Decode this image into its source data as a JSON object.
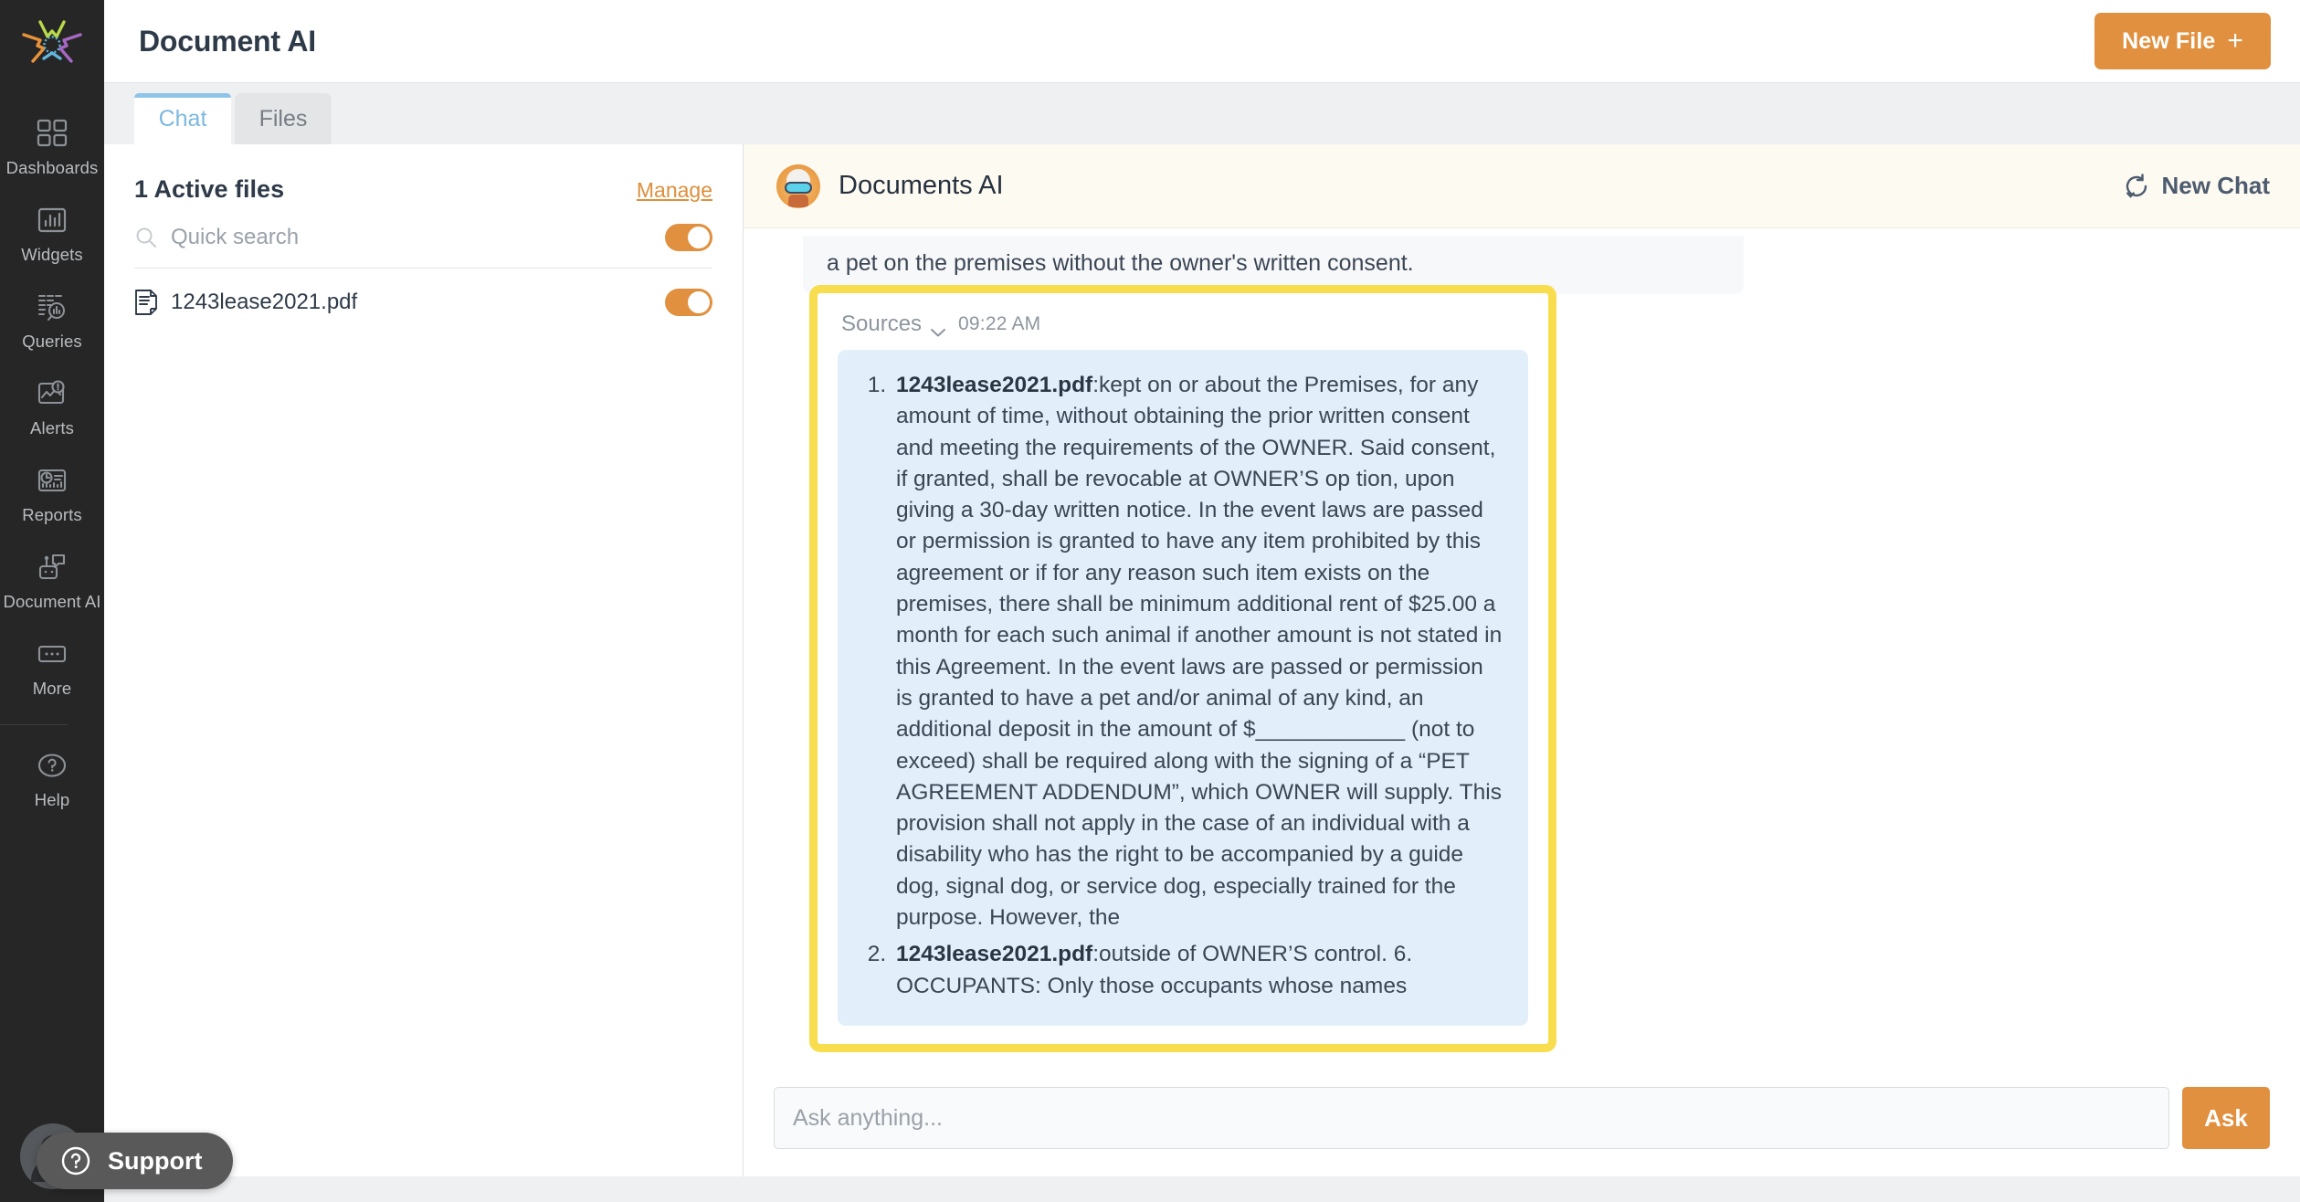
{
  "sidebar": {
    "logo_icon": "star-burst-logo",
    "items": [
      {
        "label": "Dashboards",
        "icon": "grid-icon"
      },
      {
        "label": "Widgets",
        "icon": "bar-chart-icon"
      },
      {
        "label": "Queries",
        "icon": "query-search-icon"
      },
      {
        "label": "Alerts",
        "icon": "alert-monitor-icon"
      },
      {
        "label": "Reports",
        "icon": "report-clock-icon"
      },
      {
        "label": "Document AI",
        "icon": "robot-chat-icon"
      },
      {
        "label": "More",
        "icon": "ellipsis-box-icon"
      },
      {
        "label": "Help",
        "icon": "question-circle-icon"
      }
    ],
    "avatar_icon": "user-avatar-icon"
  },
  "header": {
    "title": "Document AI",
    "new_file_label": "New File",
    "new_file_plus": "+"
  },
  "tabs": [
    {
      "label": "Chat",
      "active": true
    },
    {
      "label": "Files",
      "active": false
    }
  ],
  "files_panel": {
    "count_label": "1 Active files",
    "manage_label": "Manage",
    "search": {
      "placeholder": "Quick search",
      "value": "",
      "icon": "search-icon",
      "toggle_on": true
    },
    "files": [
      {
        "name": "1243lease2021.pdf",
        "icon": "document-icon",
        "toggle_on": true
      }
    ]
  },
  "chat": {
    "bot_name": "Documents AI",
    "bot_avatar_icon": "robot-avatar-icon",
    "new_chat_label": "New Chat",
    "new_chat_icon": "refresh-icon",
    "previous_message_tail": "a pet on the premises without the owner's written consent.",
    "sources": {
      "toggle_label": "Sources",
      "chevron_icon": "chevron-down-icon",
      "timestamp": "09:22 AM",
      "items": [
        {
          "source": "1243lease2021.pdf",
          "text": ":kept on or about the Premises, for any amount of time, without obtaining the prior written consent and meeting the requirements of the OWNER. Said consent, if granted, shall be revocable at OWNER’S op tion, upon giving a 30-day written notice. In the event laws are passed or permission is granted to have any item prohibited by this agreement or if for any reason such item exists on the premises, there shall be minimum additional rent of $25.00 a month for each such animal if another amount is not stated in this Agreement. In the event laws are passed or permission is granted to have a pet and/or animal of any kind, an additional deposit in the amount of $____________ (not to exceed) shall be required along with the signing of a “PET AGREEMENT ADDENDUM”, which OWNER will supply. This provision shall not apply in the case of an individual with a disability who has the right to be accompanied by a guide dog, signal dog, or service dog, especially trained for the purpose. However, the"
        },
        {
          "source": "1243lease2021.pdf",
          "text": ":outside of OWNER’S control. 6. OCCUPANTS: Only those occupants whose names"
        }
      ]
    }
  },
  "composer": {
    "placeholder": "Ask anything...",
    "value": "",
    "ask_label": "Ask"
  },
  "support": {
    "label": "Support",
    "icon": "question-circle-icon"
  },
  "colors": {
    "accent_orange": "#e0903f",
    "highlight_yellow": "#f8de4e",
    "source_block_blue": "#e2effa",
    "active_tab_blue": "#8ec4e8",
    "rail_dark": "#262626"
  }
}
